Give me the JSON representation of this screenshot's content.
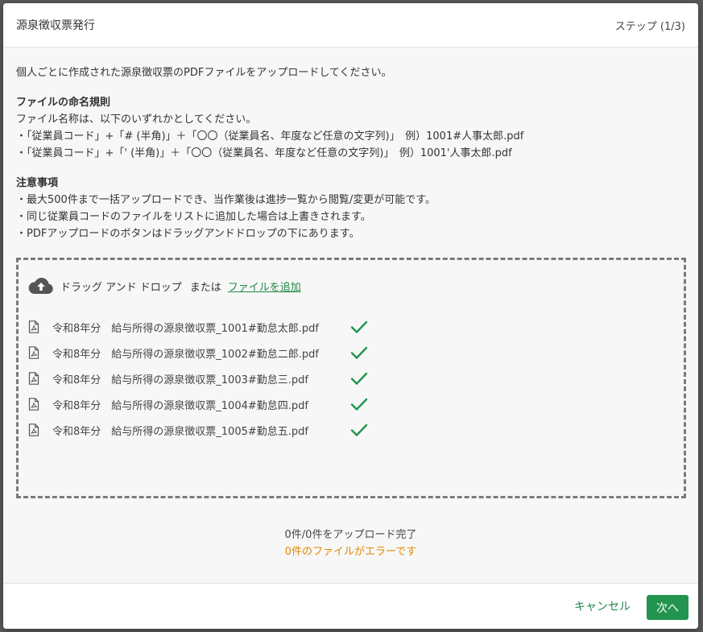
{
  "modal": {
    "title": "源泉徴収票発行",
    "step": "ステップ (1/3)"
  },
  "intro": "個人ごとに作成された源泉徴収票のPDFファイルをアップロードしてください。",
  "naming": {
    "title": "ファイルの命名規則",
    "lines": [
      "ファイル名称は、以下のいずれかとしてください。",
      "・「従業員コード」+「# (半角)」＋「〇〇（従業員名、年度など任意の文字列)」　例）1001#人事太郎.pdf",
      "・「従業員コード」+「' (半角)」＋「〇〇（従業員名、年度など任意の文字列)」　例）1001'人事太郎.pdf"
    ]
  },
  "notes": {
    "title": "注意事項",
    "lines": [
      "・最大500件まで一括アップロードでき、当作業後は進捗一覧から閲覧/変更が可能です。",
      "・同じ従業員コードのファイルをリストに追加した場合は上書きされます。",
      "・PDFアップロードのボタンはドラッグアンドドロップの下にあります。"
    ]
  },
  "dropzone": {
    "prompt": "ドラッグ アンド ドロップ",
    "or": "または",
    "add_link": "ファイルを追加"
  },
  "files": [
    {
      "name": "令和8年分　給与所得の源泉徴収票_1001#勤怠太郎.pdf",
      "status": "ok"
    },
    {
      "name": "令和8年分　給与所得の源泉徴収票_1002#勤怠二郎.pdf",
      "status": "ok"
    },
    {
      "name": "令和8年分　給与所得の源泉徴収票_1003#勤怠三.pdf",
      "status": "ok"
    },
    {
      "name": "令和8年分　給与所得の源泉徴収票_1004#勤怠四.pdf",
      "status": "ok"
    },
    {
      "name": "令和8年分　給与所得の源泉徴収票_1005#勤怠五.pdf",
      "status": "ok"
    }
  ],
  "status": {
    "uploaded": "0件/0件をアップロード完了",
    "errors": "0件のファイルがエラーです"
  },
  "footer": {
    "cancel_label": "キャンセル",
    "next_label": "次へ"
  },
  "icons": {
    "upload": "cloud-upload-icon",
    "file": "pdf-file-icon",
    "check": "check-icon"
  },
  "colors": {
    "accent": "#22944f",
    "link": "#22884a",
    "warning": "#e08a00"
  }
}
